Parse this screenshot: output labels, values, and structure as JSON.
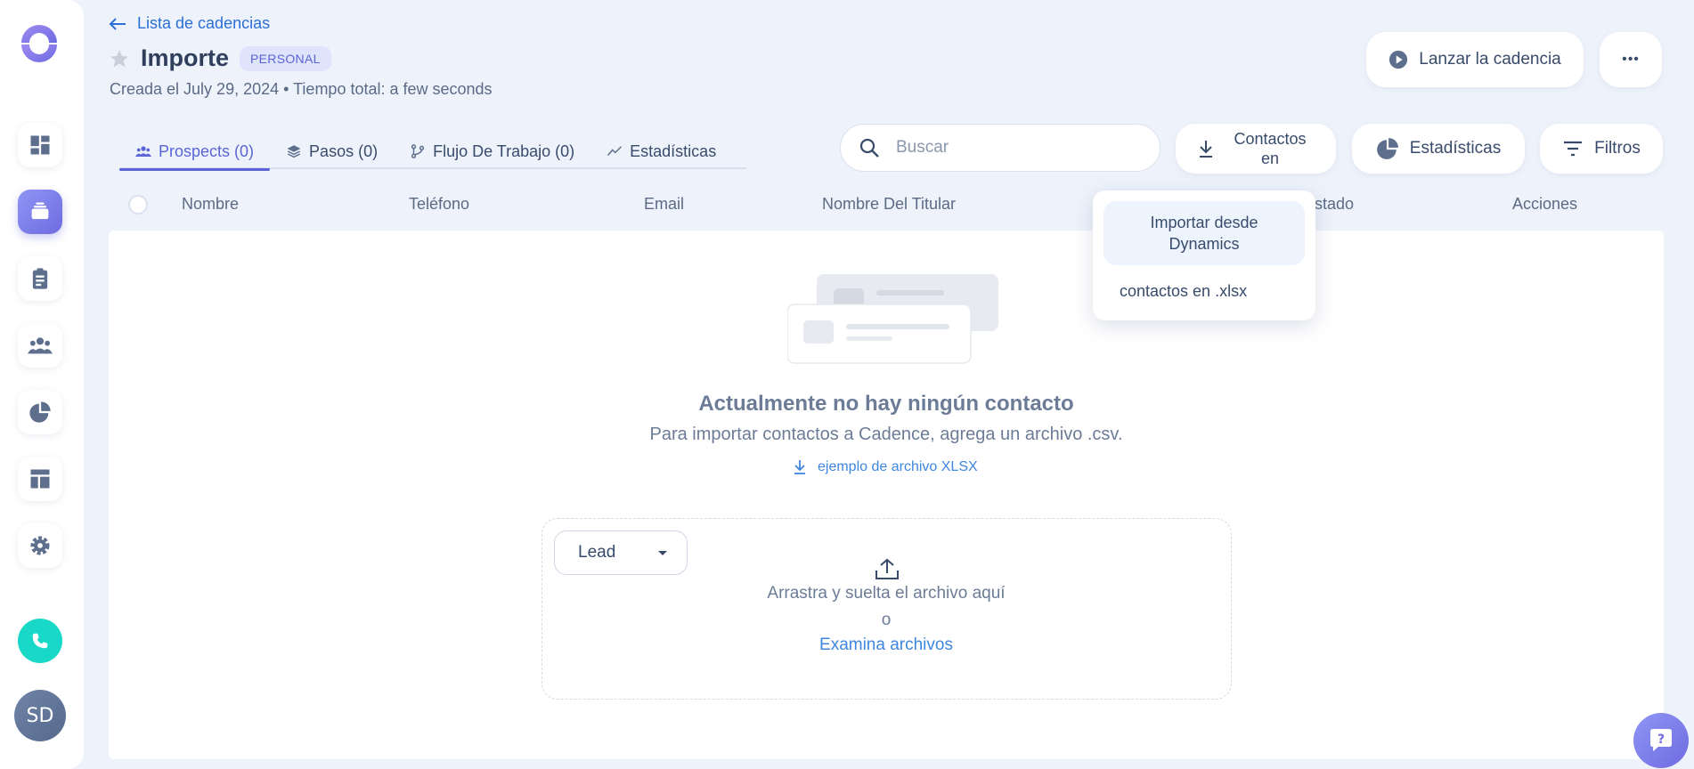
{
  "header": {
    "back_label": "Lista de cadencias",
    "title": "Importe",
    "badge": "PERSONAL",
    "meta": "Creada el July 29, 2024 • Tiempo total: a few seconds",
    "launch_label": "Lanzar la cadencia",
    "more_label": "•••"
  },
  "tabs": [
    {
      "label": "Prospects (0)",
      "icon": "people-icon",
      "active": true
    },
    {
      "label": "Pasos (0)",
      "icon": "layers-icon"
    },
    {
      "label": "Flujo De Trabajo (0)",
      "icon": "workflow-icon"
    },
    {
      "label": "Estadísticas",
      "icon": "trend-icon"
    }
  ],
  "toolbar": {
    "search_placeholder": "Buscar",
    "contacts_label": "Contactos en",
    "stats_label": "Estadísticas",
    "filters_label": "Filtros"
  },
  "table": {
    "columns": [
      "Nombre",
      "Teléfono",
      "Email",
      "Nombre Del Titular",
      "stado",
      "Acciones"
    ]
  },
  "dropdown": {
    "items": [
      "Importar desde Dynamics",
      "contactos en .xlsx"
    ]
  },
  "empty": {
    "title": "Actualmente no hay ningún contacto",
    "subtitle": "Para importar contactos a Cadence, agrega un archivo .csv.",
    "sample_link": "ejemplo de archivo XLSX"
  },
  "upload": {
    "type_selected": "Lead",
    "drag_text": "Arrastra y suelta el archivo aquí",
    "or_text": "o",
    "browse_text": "Examina archivos"
  },
  "user": {
    "initials": "SD"
  },
  "colors": {
    "accent": "#5a64d6",
    "link": "#3f86e0",
    "phone": "#18d9c8",
    "background": "#eef3fb"
  }
}
